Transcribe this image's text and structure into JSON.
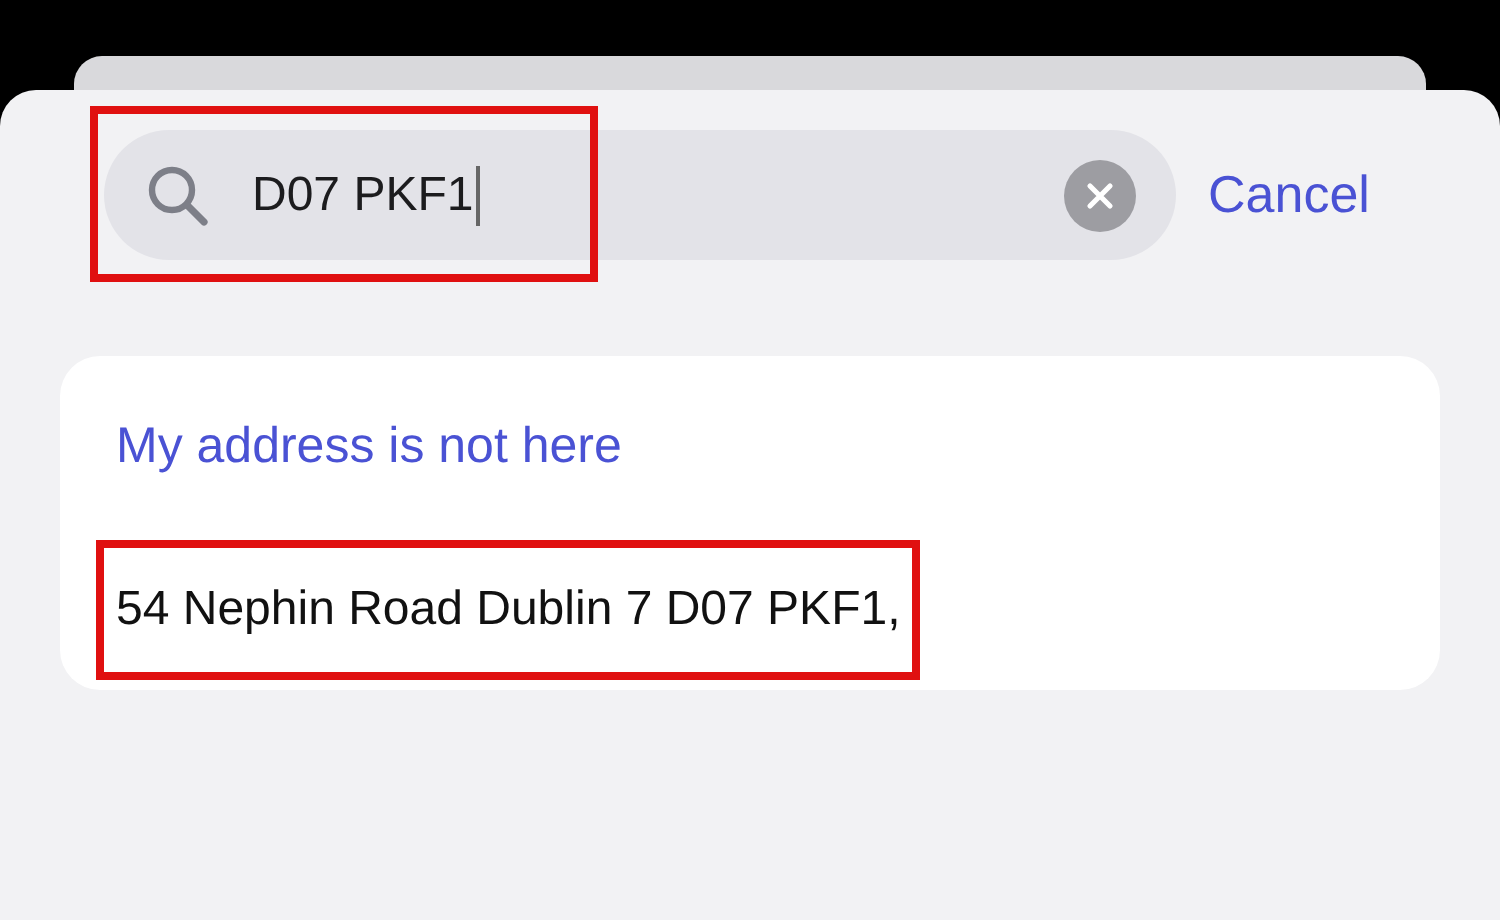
{
  "search": {
    "value": "D07 PKF1",
    "highlighted": true
  },
  "cancel": "Cancel",
  "results": [
    {
      "kind": "link",
      "text": "My address is not here",
      "highlighted": false
    },
    {
      "kind": "address",
      "text": "54 Nephin Road Dublin 7 D07 PKF1,",
      "highlighted": true
    }
  ]
}
